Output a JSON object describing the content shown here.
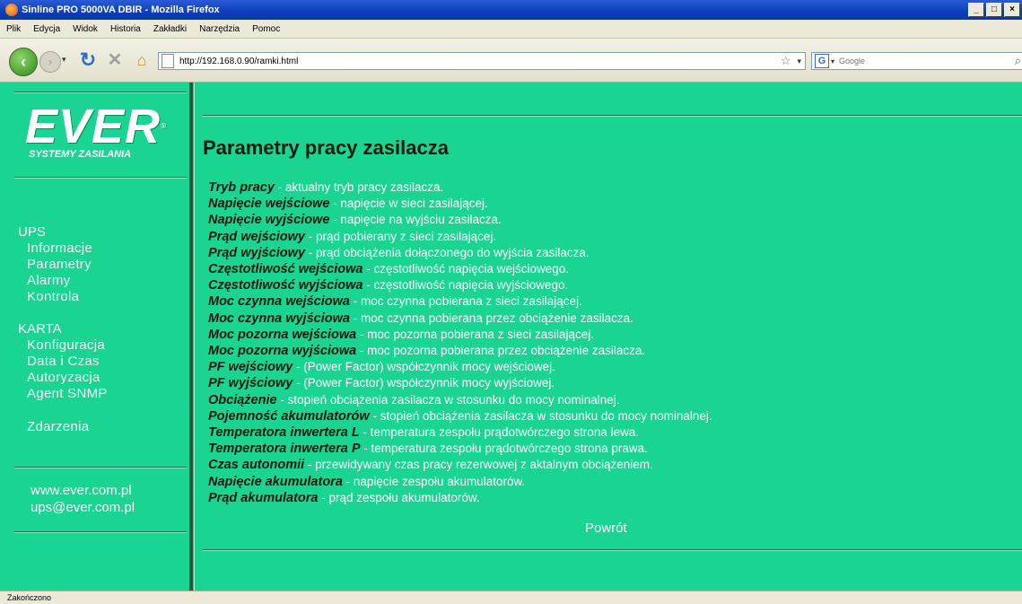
{
  "window": {
    "title": "Sinline PRO 5000VA DBIR - Mozilla Firefox",
    "min": "_",
    "max": "□",
    "close": "×"
  },
  "menu": [
    "Plik",
    "Edycja",
    "Widok",
    "Historia",
    "Zakładki",
    "Narzędzia",
    "Pomoc"
  ],
  "toolbar": {
    "url": "http://192.168.0.90/ramki.html",
    "search_placeholder": "Google"
  },
  "sidebar": {
    "logo_main": "EVER",
    "logo_reg": "®",
    "logo_sub": "SYSTEMY ZASILANIA",
    "ups_heading": "UPS",
    "ups_items": [
      "Informacje",
      "Parametry",
      "Alarmy",
      "Kontrola"
    ],
    "karta_heading": "KARTA",
    "karta_items": [
      "Konfiguracja",
      "Data i Czas",
      "Autoryzacja",
      "Agent SNMP"
    ],
    "events": "Zdarzenia",
    "website": "www.ever.com.pl",
    "email": "ups@ever.com.pl"
  },
  "main": {
    "title": "Parametry pracy zasilacza",
    "params": [
      {
        "term": "Tryb pracy",
        "desc": " - aktualny tryb pracy zasilacza."
      },
      {
        "term": "Napięcie wejściowe",
        "desc": " - napięcie w sieci zasilającej."
      },
      {
        "term": "Napięcie wyjściowe",
        "desc": " - napięcie na wyjściu zasilacza."
      },
      {
        "term": "Prąd wejściowy",
        "desc": " - prąd pobierany z sieci zasilającej."
      },
      {
        "term": "Prąd wyjściowy",
        "desc": " - prąd obciążenia dołączonego do wyjścia zasilacza."
      },
      {
        "term": "Częstotliwość wejściowa",
        "desc": " - częstotliwość napięcia wejściowego."
      },
      {
        "term": "Częstotliwość wyjściowa",
        "desc": " - częstotliwość napięcia wyjściowego."
      },
      {
        "term": "Moc czynna wejściowa",
        "desc": " - moc czynna pobierana z sieci zasilającej."
      },
      {
        "term": "Moc czynna wyjściowa",
        "desc": " - moc czynna pobierana przez obciążenie zasilacza."
      },
      {
        "term": "Moc pozorna wejściowa",
        "desc": " - moc pozorna pobierana z sieci zasilającej."
      },
      {
        "term": "Moc pozorna wyjściowa",
        "desc": " - moc pozorna pobierana przez obciążenie zasilacza."
      },
      {
        "term": "PF wejściowy",
        "desc": " - (Power Factor) współczynnik mocy wejściowej."
      },
      {
        "term": "PF wyjściowy",
        "desc": " - (Power Factor) współczynnik mocy wyjściowej."
      },
      {
        "term": "Obciążenie",
        "desc": " - stopień obciążenia zasilacza w stosunku do mocy nominalnej."
      },
      {
        "term": "Pojemność akumulatorów",
        "desc": " - stopień obciążenia zasilacza w stosunku do mocy nominalnej."
      },
      {
        "term": "Temperatora inwertera L",
        "desc": " - temperatura zespołu prądotwórczego strona lewa."
      },
      {
        "term": "Temperatora inwertera P",
        "desc": " - temperatura zespołu prądotwórczego strona prawa."
      },
      {
        "term": "Czas autonomii",
        "desc": " - przewidywany czas pracy rezerwowej z aktalnym obciążeniem."
      },
      {
        "term": "Napięcie akumulatora",
        "desc": " - napięcie zespołu akumulatorów."
      },
      {
        "term": "Prąd akumulatora",
        "desc": " - prąd zespołu akumulatorów."
      }
    ],
    "back_link": "Powrót"
  },
  "status": "Zakończono"
}
